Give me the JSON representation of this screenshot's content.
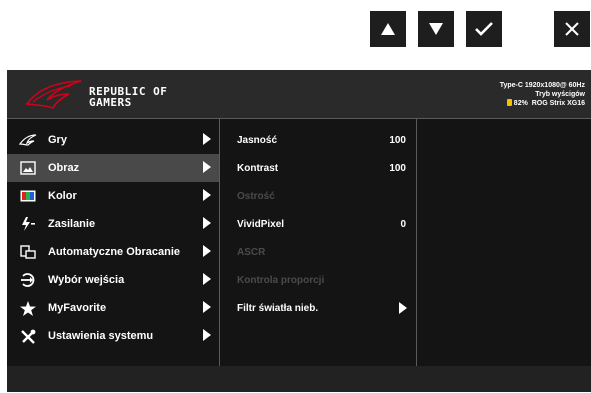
{
  "nav_keys": [
    {
      "name": "up-arrow-icon",
      "glyph": "▲"
    },
    {
      "name": "down-arrow-icon",
      "glyph": "▼"
    },
    {
      "name": "checkmark-icon",
      "glyph": "✓"
    },
    {
      "name": "close-icon",
      "glyph": "✕"
    }
  ],
  "header": {
    "brand_line1": "REPUBLIC OF",
    "brand_line2": "GAMERS",
    "status_line1": "Type-C  1920x1080@  60Hz",
    "status_line2": "Tryb wyścigów",
    "status_line3_battery": "82%",
    "status_line3_model": "ROG Strix XG16",
    "battery_color": "#f2c200"
  },
  "main_menu": [
    {
      "label": "Gry",
      "icon": "rog-eye-icon",
      "selected": false
    },
    {
      "label": "Obraz",
      "icon": "image-icon",
      "selected": true
    },
    {
      "label": "Kolor",
      "icon": "color-icon",
      "selected": false
    },
    {
      "label": "Zasilanie",
      "icon": "power-icon",
      "selected": false
    },
    {
      "label": "Automatyczne Obracanie",
      "icon": "rotate-icon",
      "selected": false
    },
    {
      "label": "Wybór wejścia",
      "icon": "input-icon",
      "selected": false
    },
    {
      "label": "MyFavorite",
      "icon": "star-icon",
      "selected": false
    },
    {
      "label": "Ustawienia systemu",
      "icon": "settings-icon",
      "selected": false
    }
  ],
  "submenu": [
    {
      "label": "Jasność",
      "value": "100",
      "enabled": true
    },
    {
      "label": "Kontrast",
      "value": "100",
      "enabled": true
    },
    {
      "label": "Ostrość",
      "value": "",
      "enabled": false
    },
    {
      "label": "VividPixel",
      "value": "0",
      "enabled": true
    },
    {
      "label": "ASCR",
      "value": "",
      "enabled": false
    },
    {
      "label": "Kontrola proporcji",
      "value": "",
      "enabled": false
    },
    {
      "label": "Filtr światła nieb.",
      "value": "",
      "enabled": true,
      "has_submenu": true
    }
  ]
}
